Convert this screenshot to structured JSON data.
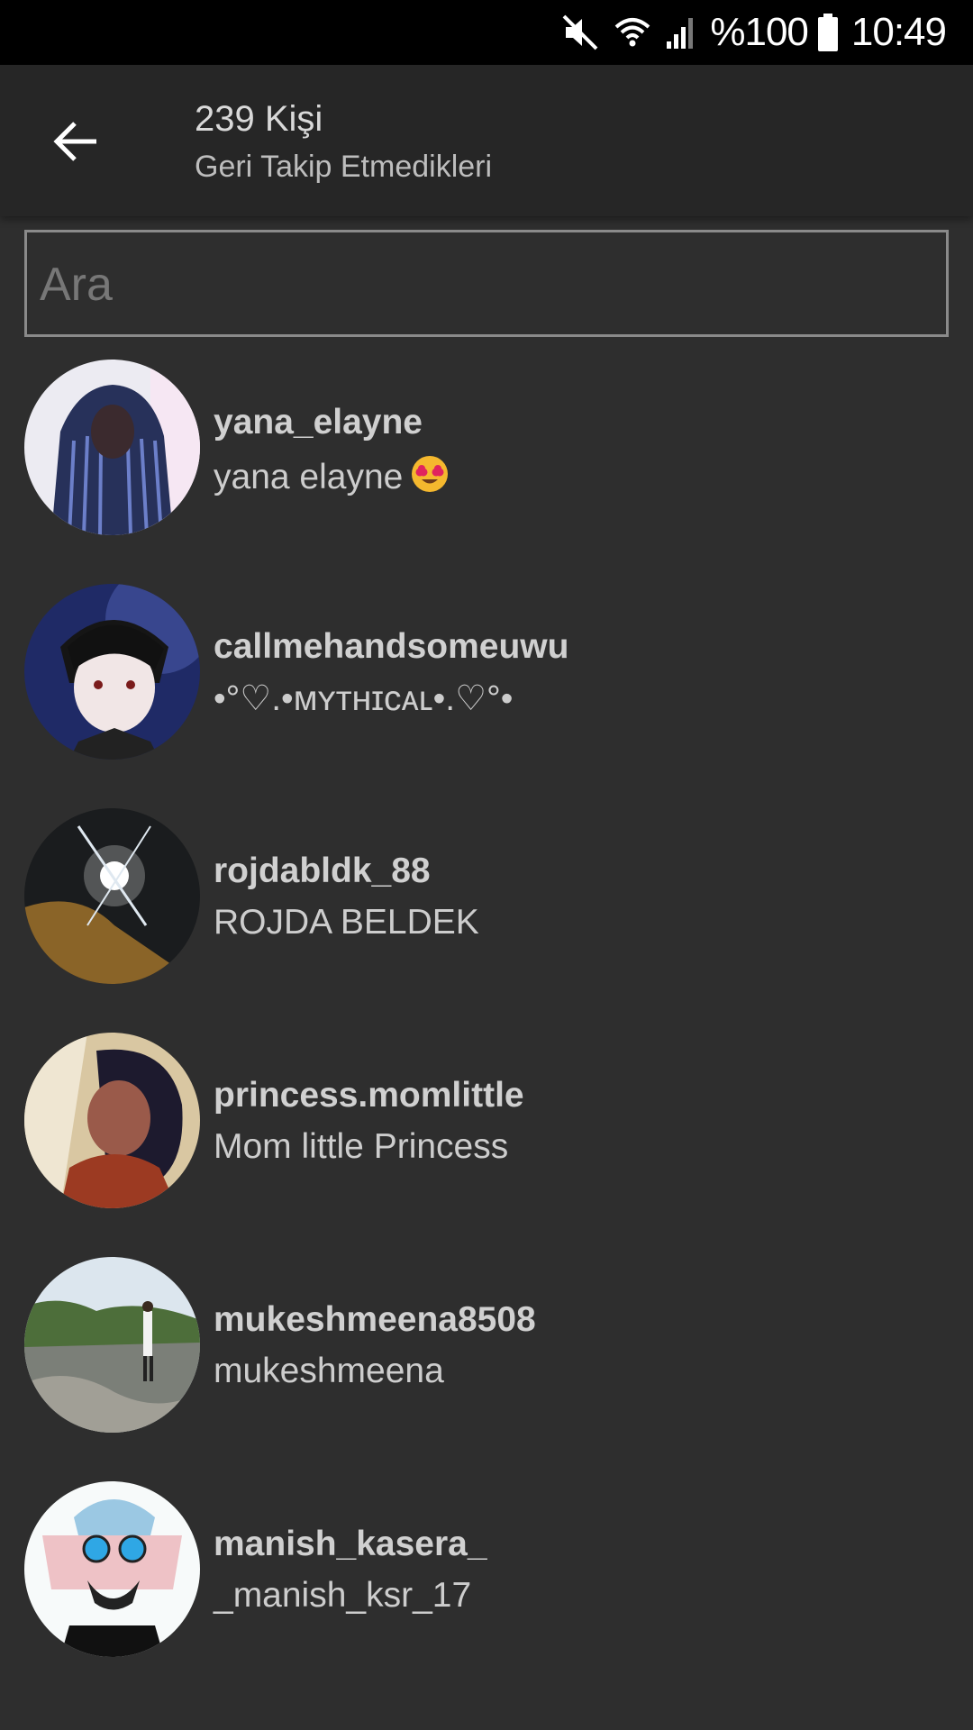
{
  "status_bar": {
    "battery_text": "%100",
    "time": "10:49",
    "icons": [
      "mute-icon",
      "wifi-icon",
      "signal-icon",
      "battery-icon"
    ]
  },
  "header": {
    "back_icon": "arrow-left-icon",
    "title": "239 Kişi",
    "subtitle": "Geri Takip Etmedikleri"
  },
  "search": {
    "placeholder": "Ara",
    "value": ""
  },
  "users": [
    {
      "username": "yana_elayne",
      "fullname": "yana elayne",
      "emoji": "heart-eyes-emoji-icon"
    },
    {
      "username": "callmehandsomeuwu",
      "fullname": "•°♡.•ᴍʏᴛʜɪᴄᴀʟ•.♡°•"
    },
    {
      "username": "rojdabldk_88",
      "fullname": "ROJDA BELDEK"
    },
    {
      "username": "princess.momlittle",
      "fullname": "Mom little Princess"
    },
    {
      "username": "mukeshmeena8508",
      "fullname": "mukeshmeena"
    },
    {
      "username": "manish_kasera_",
      "fullname": "_manish_ksr_17"
    }
  ],
  "colors": {
    "background": "#2e2e2e",
    "app_bar": "#262626",
    "status_bar": "#000000",
    "text_primary": "#d0d0d0",
    "search_border": "#8a8a8a"
  }
}
